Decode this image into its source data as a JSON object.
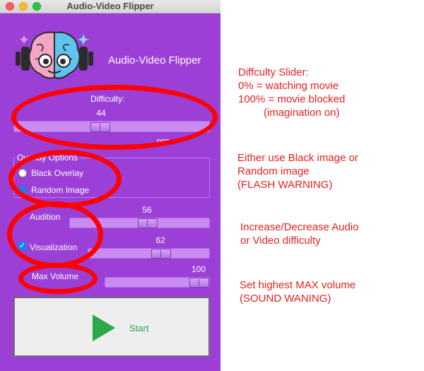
{
  "window": {
    "title": "Audio-Video Flipper"
  },
  "header": {
    "app_name": "Audio-Video Flipper",
    "logo_icon": "brain-headphones-logo"
  },
  "difficulty": {
    "label": "Difficulty:",
    "value": "44",
    "percent": 44,
    "partial_label": "ngs"
  },
  "overlay": {
    "title": "Overlay Options",
    "options": [
      "Black Overlay",
      "Random Image"
    ],
    "selected": "Black Overlay"
  },
  "audition": {
    "label": "Audition",
    "value": "56",
    "percent": 56
  },
  "visualization": {
    "label": "Visualization",
    "value": "62",
    "percent": 62,
    "checked": true
  },
  "max_volume": {
    "label": "Max Volume",
    "value": "100",
    "percent": 100
  },
  "start": {
    "label": "Start",
    "icon": "play-icon",
    "color": "#2aa84a"
  },
  "annotations": {
    "difficulty": [
      "Diffculty Slider:",
      "0% = watching movie",
      "100% = movie blocked",
      "(imagination on)"
    ],
    "overlay": [
      "Either use Black image or",
      "Random image",
      "(FLASH WARNING)"
    ],
    "audio_video": [
      "Increase/Decrease Audio",
      "or Video difficulty"
    ],
    "volume": [
      "Set highest MAX volume",
      "(SOUND WANING)"
    ]
  },
  "colors": {
    "window_bg": "#9b3fd6",
    "annotation": "#e8211f",
    "ellipse": "#ff0000"
  }
}
